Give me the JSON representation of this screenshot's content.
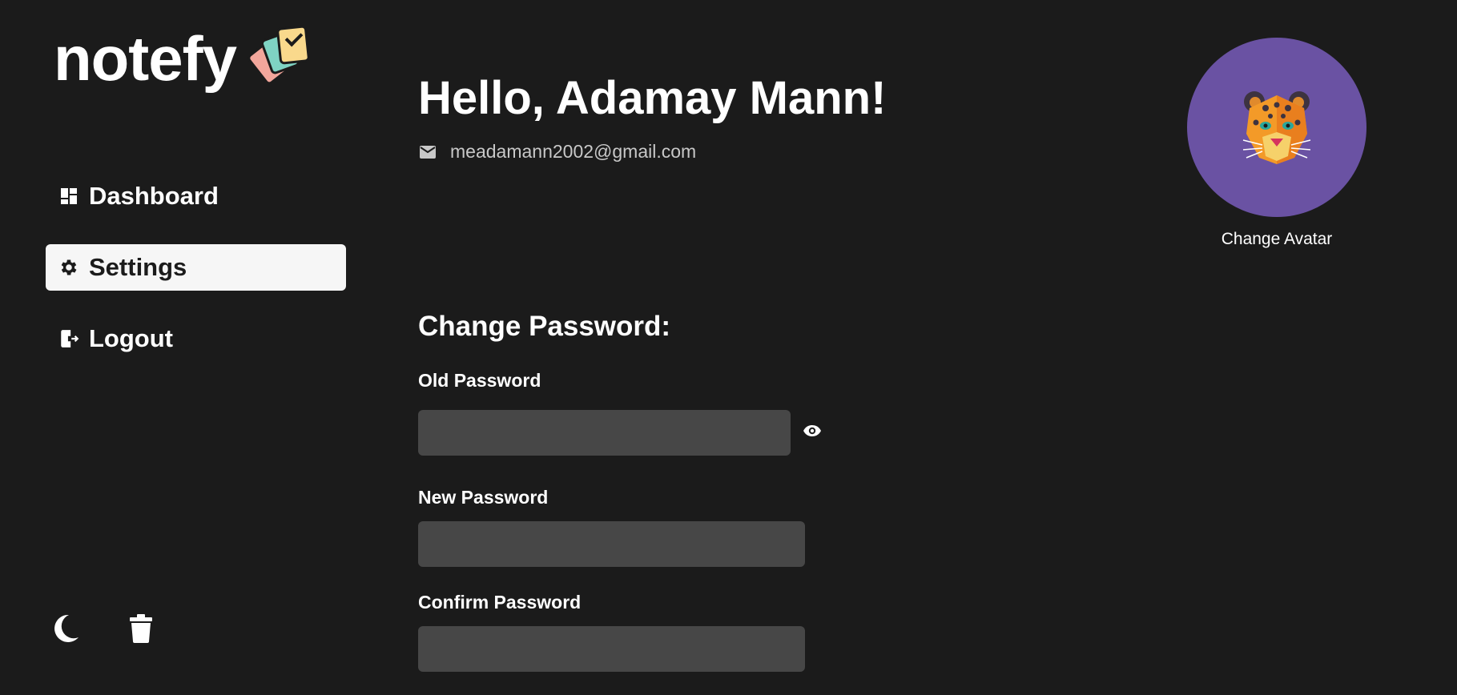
{
  "app": {
    "brand": "notefy",
    "logo_icon": "cards-check-icon"
  },
  "sidebar": {
    "items": [
      {
        "label": "Dashboard",
        "icon": "dashboard-icon",
        "active": false
      },
      {
        "label": "Settings",
        "icon": "gear-icon",
        "active": true
      },
      {
        "label": "Logout",
        "icon": "logout-icon",
        "active": false
      }
    ],
    "bottom_icons": [
      "moon-icon",
      "trash-icon"
    ]
  },
  "profile": {
    "greeting": "Hello, Adamay Mann!",
    "email": "meadamann2002@gmail.com",
    "avatar_label": "Change Avatar",
    "avatar_bg": "#6a52a3"
  },
  "password": {
    "title": "Change Password:",
    "old_label": "Old Password",
    "new_label": "New Password",
    "confirm_label": "Confirm Password",
    "old_value": "",
    "new_value": "",
    "confirm_value": ""
  },
  "colors": {
    "background": "#1b1b1b",
    "input_bg": "#474747",
    "active_item_bg": "#f6f6f6",
    "muted_text": "#c8c8c8"
  }
}
